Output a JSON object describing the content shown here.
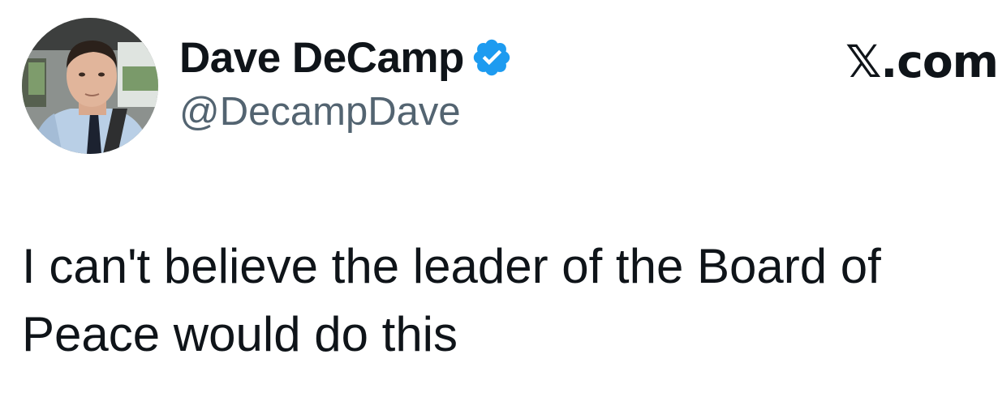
{
  "tweet": {
    "author": {
      "display_name": "Dave DeCamp",
      "handle": "@DecampDave",
      "verified": true,
      "avatar_icon": "profile-photo"
    },
    "source": "𝕏.com",
    "text": "I can't believe the leader of the Board of Peace would do this"
  },
  "colors": {
    "text_primary": "#0f1419",
    "text_secondary": "#536471",
    "verified_blue": "#1d9bf0",
    "background": "#ffffff"
  }
}
